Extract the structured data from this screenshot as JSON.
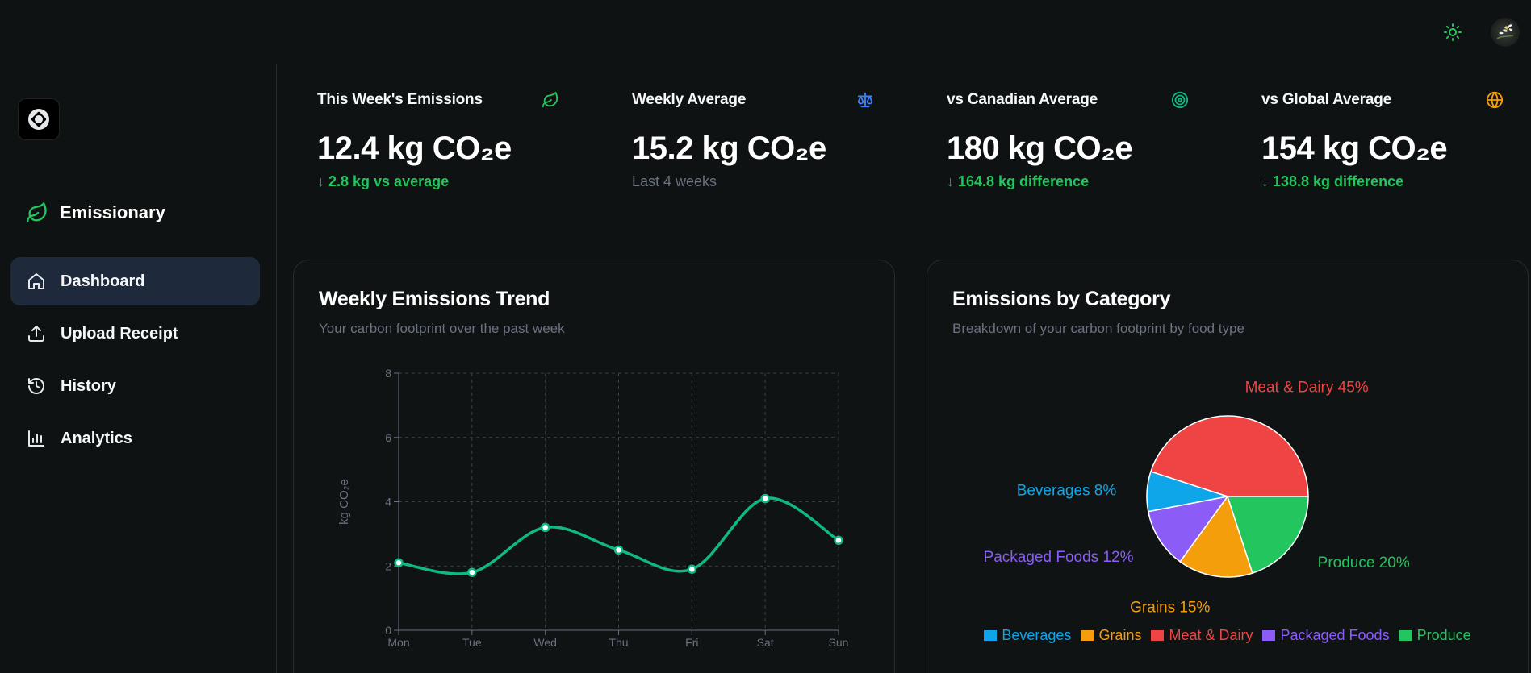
{
  "app": {
    "name": "Emissionary"
  },
  "nav": {
    "items": [
      {
        "label": "Dashboard",
        "icon": "home-icon",
        "active": true
      },
      {
        "label": "Upload Receipt",
        "icon": "upload-icon",
        "active": false
      },
      {
        "label": "History",
        "icon": "history-icon",
        "active": false
      },
      {
        "label": "Analytics",
        "icon": "bar-chart-icon",
        "active": false
      }
    ]
  },
  "stats": [
    {
      "title": "This Week's Emissions",
      "value": "12.4 kg CO₂e",
      "sub": "↓ 2.8 kg vs average",
      "sub_color": "green",
      "icon": "leaf-icon",
      "icon_color": "#22c55e"
    },
    {
      "title": "Weekly Average",
      "value": "15.2 kg CO₂e",
      "sub": "Last 4 weeks",
      "sub_color": "gray",
      "icon": "scale-icon",
      "icon_color": "#3b82f6"
    },
    {
      "title": "vs Canadian Average",
      "value": "180 kg CO₂e",
      "sub": "↓ 164.8 kg difference",
      "sub_color": "green",
      "icon": "target-icon",
      "icon_color": "#10b981"
    },
    {
      "title": "vs Global Average",
      "value": "154 kg CO₂e",
      "sub": "↓ 138.8 kg difference",
      "sub_color": "green",
      "icon": "globe-icon",
      "icon_color": "#f59e0b"
    }
  ],
  "trend_card": {
    "title": "Weekly Emissions Trend",
    "subtitle": "Your carbon footprint over the past week"
  },
  "category_card": {
    "title": "Emissions by Category",
    "subtitle": "Breakdown of your carbon footprint by food type"
  },
  "colors": {
    "accent": "#10b981",
    "background": "#0e1212"
  },
  "chart_data": [
    {
      "type": "line",
      "categories": [
        "Mon",
        "Tue",
        "Wed",
        "Thu",
        "Fri",
        "Sat",
        "Sun"
      ],
      "series": [
        {
          "values": [
            2.1,
            1.8,
            3.2,
            2.5,
            1.9,
            4.1,
            2.8
          ],
          "color": "#10b981"
        }
      ],
      "ylabel": "kg CO₂e",
      "ylim": [
        0,
        8
      ],
      "yticks": [
        0,
        2,
        4,
        6,
        8
      ],
      "grid": true
    },
    {
      "type": "pie",
      "slices": [
        {
          "label": "Meat & Dairy",
          "value": 45,
          "color": "#ef4444"
        },
        {
          "label": "Beverages",
          "value": 8,
          "color": "#0ea5e9"
        },
        {
          "label": "Packaged Foods",
          "value": 12,
          "color": "#8b5cf6"
        },
        {
          "label": "Grains",
          "value": 15,
          "color": "#f59e0b"
        },
        {
          "label": "Produce",
          "value": 20,
          "color": "#22c55e"
        }
      ],
      "legend": [
        {
          "label": "Beverages",
          "color": "#0ea5e9"
        },
        {
          "label": "Grains",
          "color": "#f59e0b"
        },
        {
          "label": "Meat & Dairy",
          "color": "#ef4444"
        },
        {
          "label": "Packaged Foods",
          "color": "#8b5cf6"
        },
        {
          "label": "Produce",
          "color": "#22c55e"
        }
      ],
      "legend_position": "bottom"
    }
  ]
}
